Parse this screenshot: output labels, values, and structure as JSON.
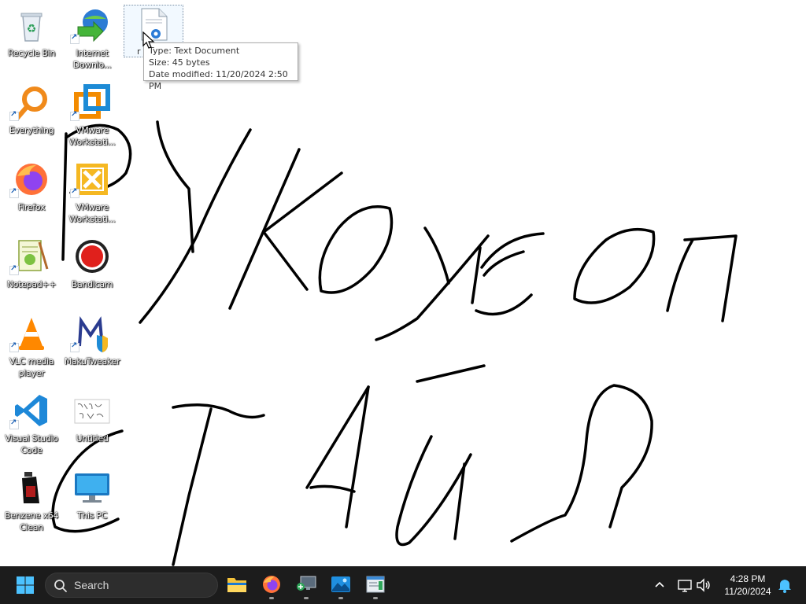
{
  "desktop": {
    "icons": [
      {
        "label": "Recycle Bin",
        "icon": "recycle-bin-icon"
      },
      {
        "label": "Internet Downlo...",
        "icon": "internet-download-manager-icon"
      },
      {
        "label": "Everything",
        "icon": "everything-search-icon"
      },
      {
        "label": "VMware Workstati...",
        "icon": "vmware-workstation-icon"
      },
      {
        "label": "Firefox",
        "icon": "firefox-icon"
      },
      {
        "label": "VMware Workstati...",
        "icon": "vmware-player-icon"
      },
      {
        "label": "Notepad++",
        "icon": "notepad-plus-plus-icon"
      },
      {
        "label": "Bandicam",
        "icon": "bandicam-icon"
      },
      {
        "label": "VLC media player",
        "icon": "vlc-icon"
      },
      {
        "label": "MakuTweaker",
        "icon": "makutweaker-icon"
      },
      {
        "label": "Visual Studio Code",
        "icon": "vscode-icon"
      },
      {
        "label": "Untitled",
        "icon": "image-file-icon"
      },
      {
        "label": "Benzene x64 Clean",
        "icon": "benzene-icon"
      },
      {
        "label": "This PC",
        "icon": "this-pc-icon"
      }
    ],
    "selected_file": {
      "label": "r",
      "icon": "text-document-icon"
    },
    "tooltip": {
      "type": "Type: Text Document",
      "size": "Size: 45 bytes",
      "modified": "Date modified: 11/20/2024 2:50 PM"
    },
    "handwriting_color": "#000000"
  },
  "taskbar": {
    "background": "#1c1c1c",
    "start_icon": "windows-start-icon",
    "search_placeholder": "Search",
    "apps": [
      {
        "name": "file-explorer-icon"
      },
      {
        "name": "firefox-icon"
      },
      {
        "name": "remote-desktop-icon"
      },
      {
        "name": "photos-icon"
      },
      {
        "name": "notepad-icon"
      }
    ],
    "tray": {
      "chevron": "chevron-up-icon",
      "network": "network-icon",
      "volume": "volume-icon",
      "notification": "notification-bell-icon"
    },
    "clock": {
      "time": "4:28 PM",
      "date": "11/20/2024"
    }
  }
}
